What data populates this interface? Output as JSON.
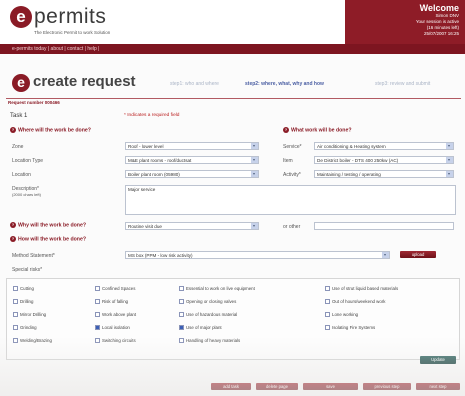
{
  "brand": {
    "logo_letter": "e",
    "name": "permits",
    "tagline": "The Electronic Permit to work Solution"
  },
  "welcome": {
    "title": "Welcome",
    "lines": [
      "Simon DNV",
      "Your session is active",
      "(16 minutes left)",
      "25/07/2007 16:25"
    ]
  },
  "nav": {
    "text": "e-permits today | about | contact | help |"
  },
  "page": {
    "title_letter": "e",
    "title": "create request",
    "steps": [
      "step1: who and where",
      "step2: where, what, why and how",
      "step3: review and submit"
    ],
    "active_step": 1,
    "request_label": "Request number 000466",
    "task_label": "Task",
    "task_number": "1",
    "required_note": "* Indicates a required field"
  },
  "where": {
    "heading": "Where will the work be done?",
    "fields": [
      {
        "label": "Zone",
        "value": "Roof - lower level"
      },
      {
        "label": "Location Type",
        "value": "M&E plant rooms - roof/ductsat"
      },
      {
        "label": "Location",
        "value": "Boiler plant room (05980)"
      }
    ],
    "description_label": "Description*",
    "description_hint": "(2000 chars left)",
    "description_value": "Major service"
  },
  "what": {
    "heading": "What work will be done?",
    "fields": [
      {
        "label": "Service*",
        "value": "Air conditioning & Heating system"
      },
      {
        "label": "Item",
        "value": "De District boiler - DTS 400 250kw (AC)"
      },
      {
        "label": "Activity*",
        "value": "Maintaining / testing / operating"
      }
    ]
  },
  "why": {
    "heading": "Why will the work be done?",
    "value": "Routine visit due",
    "or_other": "or other"
  },
  "how": {
    "heading": "How will the work be done?",
    "method_label": "Method Statement*",
    "method_value": "MS box (PPM - low risk activity)",
    "method_button": "upload",
    "special_label": "Special risks*"
  },
  "checkboxes": [
    [
      {
        "label": "Cutting",
        "checked": false
      },
      {
        "label": "Drilling",
        "checked": false
      },
      {
        "label": "Mirror Drilling",
        "checked": false
      },
      {
        "label": "Grinding",
        "checked": false
      },
      {
        "label": "Welding/Brazing",
        "checked": false
      }
    ],
    [
      {
        "label": "Confined Spaces",
        "checked": false
      },
      {
        "label": "Risk of falling",
        "checked": false
      },
      {
        "label": "Work above plant",
        "checked": false
      },
      {
        "label": "Local isolation",
        "checked": true
      },
      {
        "label": "Switching circuits",
        "checked": false
      }
    ],
    [
      {
        "label": "Essential to work on live equipment",
        "checked": false
      },
      {
        "label": "Opening or closing valves",
        "checked": false
      },
      {
        "label": "Use of hazardous material",
        "checked": false
      },
      {
        "label": "Use of major plant",
        "checked": true
      },
      {
        "label": "Handling of heavy materials",
        "checked": false
      }
    ],
    [
      {
        "label": "Use of strut liquid based materials",
        "checked": false
      },
      {
        "label": "Out of hours/weekend work",
        "checked": false
      },
      {
        "label": "Lone working",
        "checked": false
      },
      {
        "label": "Isolating Fire Systems",
        "checked": false
      }
    ]
  ],
  "buttons": {
    "update": "Update",
    "bottom": [
      "add task",
      "delete page",
      "save",
      "previous step",
      "next step"
    ]
  }
}
